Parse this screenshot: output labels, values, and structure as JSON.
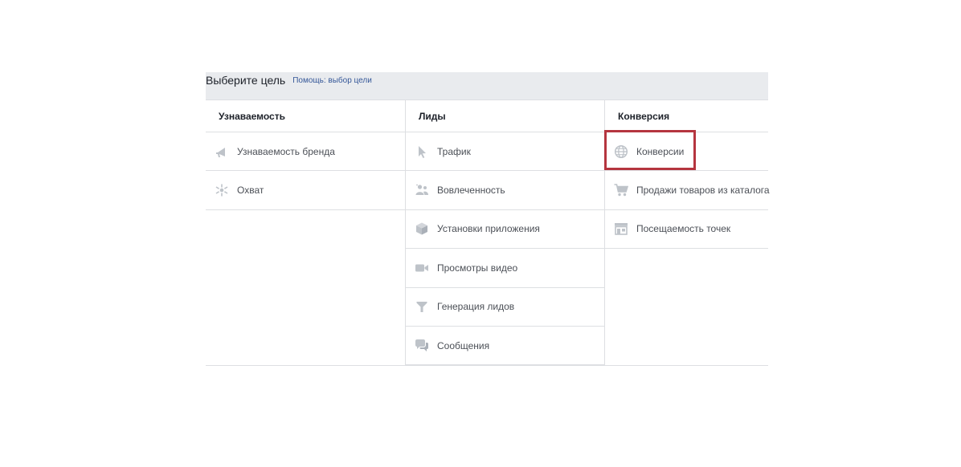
{
  "header": {
    "title": "Выберите цель",
    "help_link": "Помощь: выбор цели"
  },
  "columns": [
    {
      "title": "Узнаваемость",
      "items": [
        {
          "label": "Узнаваемость бренда",
          "icon": "megaphone-icon"
        },
        {
          "label": "Охват",
          "icon": "reach-icon"
        }
      ]
    },
    {
      "title": "Лиды",
      "items": [
        {
          "label": "Трафик",
          "icon": "cursor-icon"
        },
        {
          "label": "Вовлеченность",
          "icon": "people-icon"
        },
        {
          "label": "Установки приложения",
          "icon": "box-icon"
        },
        {
          "label": "Просмотры видео",
          "icon": "video-camera-icon"
        },
        {
          "label": "Генерация лидов",
          "icon": "funnel-icon"
        },
        {
          "label": "Сообщения",
          "icon": "chat-bubbles-icon"
        }
      ]
    },
    {
      "title": "Конверсия",
      "items": [
        {
          "label": "Конверсии",
          "icon": "globe-icon",
          "highlighted": true
        },
        {
          "label": "Продажи товаров из каталога",
          "icon": "cart-icon"
        },
        {
          "label": "Посещаемость точек",
          "icon": "store-icon"
        }
      ]
    }
  ],
  "colors": {
    "icon": "#bec3c9",
    "highlight": "#b5353f",
    "link": "#365899",
    "header_bg": "#e9ebee"
  }
}
